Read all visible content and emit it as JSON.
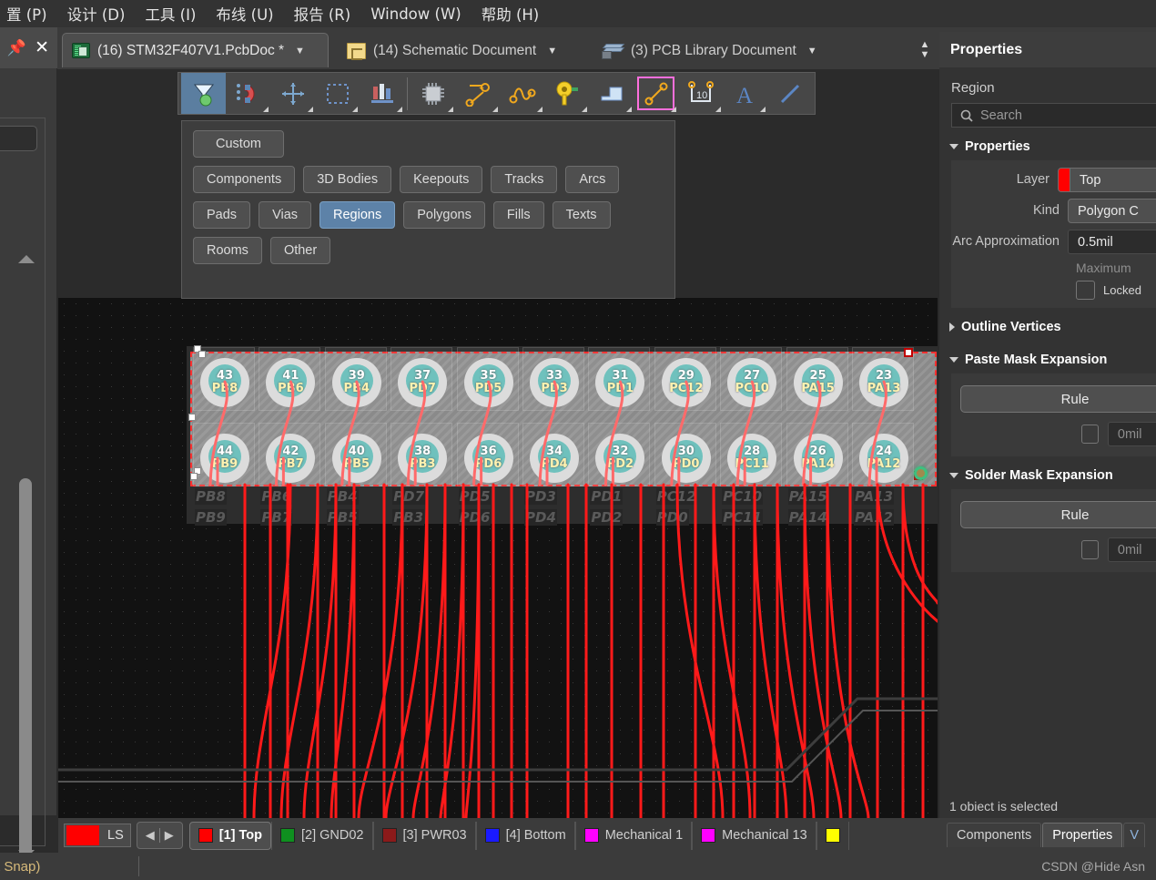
{
  "menu": {
    "items": [
      {
        "label": "置 (P)"
      },
      {
        "label": "设计 (D)"
      },
      {
        "label": "工具 (I)"
      },
      {
        "label": "布线 (U)"
      },
      {
        "label": "报告 (R)"
      },
      {
        "label": "Window (W)"
      },
      {
        "label": "帮助 (H)"
      }
    ]
  },
  "panel_header": {
    "caret_icon": "chevron-down-icon",
    "pin_icon": "pin-icon",
    "close_icon": "close-icon"
  },
  "doc_tabs": [
    {
      "label": "(16) STM32F407V1.PcbDoc *",
      "icon": "pcb-document-icon",
      "active": true
    },
    {
      "label": "(14) Schematic Document",
      "icon": "schematic-document-icon",
      "active": false
    },
    {
      "label": "(3) PCB Library Document",
      "icon": "pcb-library-icon",
      "active": false
    }
  ],
  "toolbar": {
    "buttons": [
      {
        "name": "filter-funnel-icon",
        "selected": true
      },
      {
        "name": "snap-magnet-icon",
        "selected": false
      },
      {
        "name": "move-cross-icon",
        "selected": false
      },
      {
        "name": "select-rectangle-icon",
        "selected": false
      },
      {
        "name": "align-icon",
        "selected": false
      },
      {
        "name": "place-component-icon",
        "selected": false
      },
      {
        "name": "interactive-route-icon",
        "selected": false
      },
      {
        "name": "differential-pair-route-icon",
        "selected": false
      },
      {
        "name": "place-pad-icon",
        "selected": false
      },
      {
        "name": "place-polygon-icon",
        "selected": false
      },
      {
        "name": "place-line-icon",
        "selected": false
      },
      {
        "name": "place-dimension-icon",
        "selected": false
      },
      {
        "name": "place-string-icon",
        "selected": false
      },
      {
        "name": "place-track-icon",
        "selected": false
      }
    ]
  },
  "filter_panel": {
    "rows": [
      [
        {
          "label": "Custom",
          "selected": false,
          "wide": true
        }
      ],
      [
        {
          "label": "Components",
          "selected": false
        },
        {
          "label": "3D Bodies",
          "selected": false
        },
        {
          "label": "Keepouts",
          "selected": false
        },
        {
          "label": "Tracks",
          "selected": false
        },
        {
          "label": "Arcs",
          "selected": false
        }
      ],
      [
        {
          "label": "Pads",
          "selected": false
        },
        {
          "label": "Vias",
          "selected": false
        },
        {
          "label": "Regions",
          "selected": true
        },
        {
          "label": "Polygons",
          "selected": false
        },
        {
          "label": "Fills",
          "selected": false
        },
        {
          "label": "Texts",
          "selected": false
        }
      ],
      [
        {
          "label": "Rooms",
          "selected": false
        },
        {
          "label": "Other",
          "selected": false
        }
      ]
    ]
  },
  "properties": {
    "title": "Properties",
    "object_type": "Region",
    "search_placeholder": "Search",
    "search_icon": "search-icon",
    "sections": {
      "properties": {
        "title": "Properties",
        "expanded": true,
        "layer_label": "Layer",
        "layer_value": "Top",
        "layer_color": "#ff0000",
        "kind_label": "Kind",
        "kind_value": "Polygon C",
        "arc_label": "Arc Approximation",
        "arc_value": "0.5mil",
        "arc_hint": "Maximum",
        "locked_label": "Locked",
        "locked_checked": false
      },
      "outline_vertices": {
        "title": "Outline Vertices",
        "expanded": false
      },
      "paste_mask": {
        "title": "Paste Mask Expansion",
        "expanded": true,
        "rule_label": "Rule",
        "expansion_value": "0mil",
        "expansion_checked": false
      },
      "solder_mask": {
        "title": "Solder Mask Expansion",
        "expanded": true,
        "rule_label": "Rule",
        "expansion_value": "0mil",
        "expansion_checked": false
      }
    },
    "status": "1 obiect is selected"
  },
  "layer_bar": {
    "ls_label": "LS",
    "ls_color": "#ff0000",
    "prev_icon": "left-arrow-icon",
    "next_icon": "right-arrow-icon",
    "tabs": [
      {
        "label": "[1] Top",
        "color": "#ff0000",
        "active": true
      },
      {
        "label": "[2] GND02",
        "color": "#0f8f1f",
        "active": false
      },
      {
        "label": "[3] PWR03",
        "color": "#8b1a1a",
        "active": false
      },
      {
        "label": "[4] Bottom",
        "color": "#1a1aff",
        "active": false
      },
      {
        "label": "Mechanical 1",
        "color": "#ff00ff",
        "active": false
      },
      {
        "label": "Mechanical 13",
        "color": "#ff00ff",
        "active": false
      },
      {
        "label": "",
        "color": "#ffff00",
        "active": false
      }
    ],
    "panel_tabs": [
      {
        "label": "Components",
        "active": false
      },
      {
        "label": "Properties",
        "active": true
      },
      {
        "label": "V",
        "active": false
      }
    ]
  },
  "status_bar": {
    "left_text": "t Snap)",
    "watermark": "CSDN @Hide Asn"
  },
  "canvas": {
    "pads_top_row": [
      {
        "number": "43",
        "net": "PB8"
      },
      {
        "number": "41",
        "net": "PB6"
      },
      {
        "number": "39",
        "net": "PB4"
      },
      {
        "number": "37",
        "net": "PD7"
      },
      {
        "number": "35",
        "net": "PD5"
      },
      {
        "number": "33",
        "net": "PD3"
      },
      {
        "number": "31",
        "net": "PD1"
      },
      {
        "number": "29",
        "net": "PC12"
      },
      {
        "number": "27",
        "net": "PC10"
      },
      {
        "number": "25",
        "net": "PA15"
      },
      {
        "number": "23",
        "net": "PA13"
      }
    ],
    "pads_bottom_row": [
      {
        "number": "44",
        "net": "PB9"
      },
      {
        "number": "42",
        "net": "PB7"
      },
      {
        "number": "40",
        "net": "PB5"
      },
      {
        "number": "38",
        "net": "PB3"
      },
      {
        "number": "36",
        "net": "PD6"
      },
      {
        "number": "34",
        "net": "PD4"
      },
      {
        "number": "32",
        "net": "PD2"
      },
      {
        "number": "30",
        "net": "PD0"
      },
      {
        "number": "28",
        "net": "PC11"
      },
      {
        "number": "26",
        "net": "PA14"
      },
      {
        "number": "24",
        "net": "PA12"
      }
    ],
    "silkscreen_top": [
      "PB8",
      "PB6",
      "PB4",
      "PD7",
      "PD5",
      "PD3",
      "PD1",
      "PC12",
      "PC10",
      "PA15",
      "PA13"
    ],
    "silkscreen_bottom": [
      "PB9",
      "PB7",
      "PB5",
      "PB3",
      "PD6",
      "PD4",
      "PD2",
      "PD0",
      "PC11",
      "PA14",
      "PA12"
    ]
  }
}
